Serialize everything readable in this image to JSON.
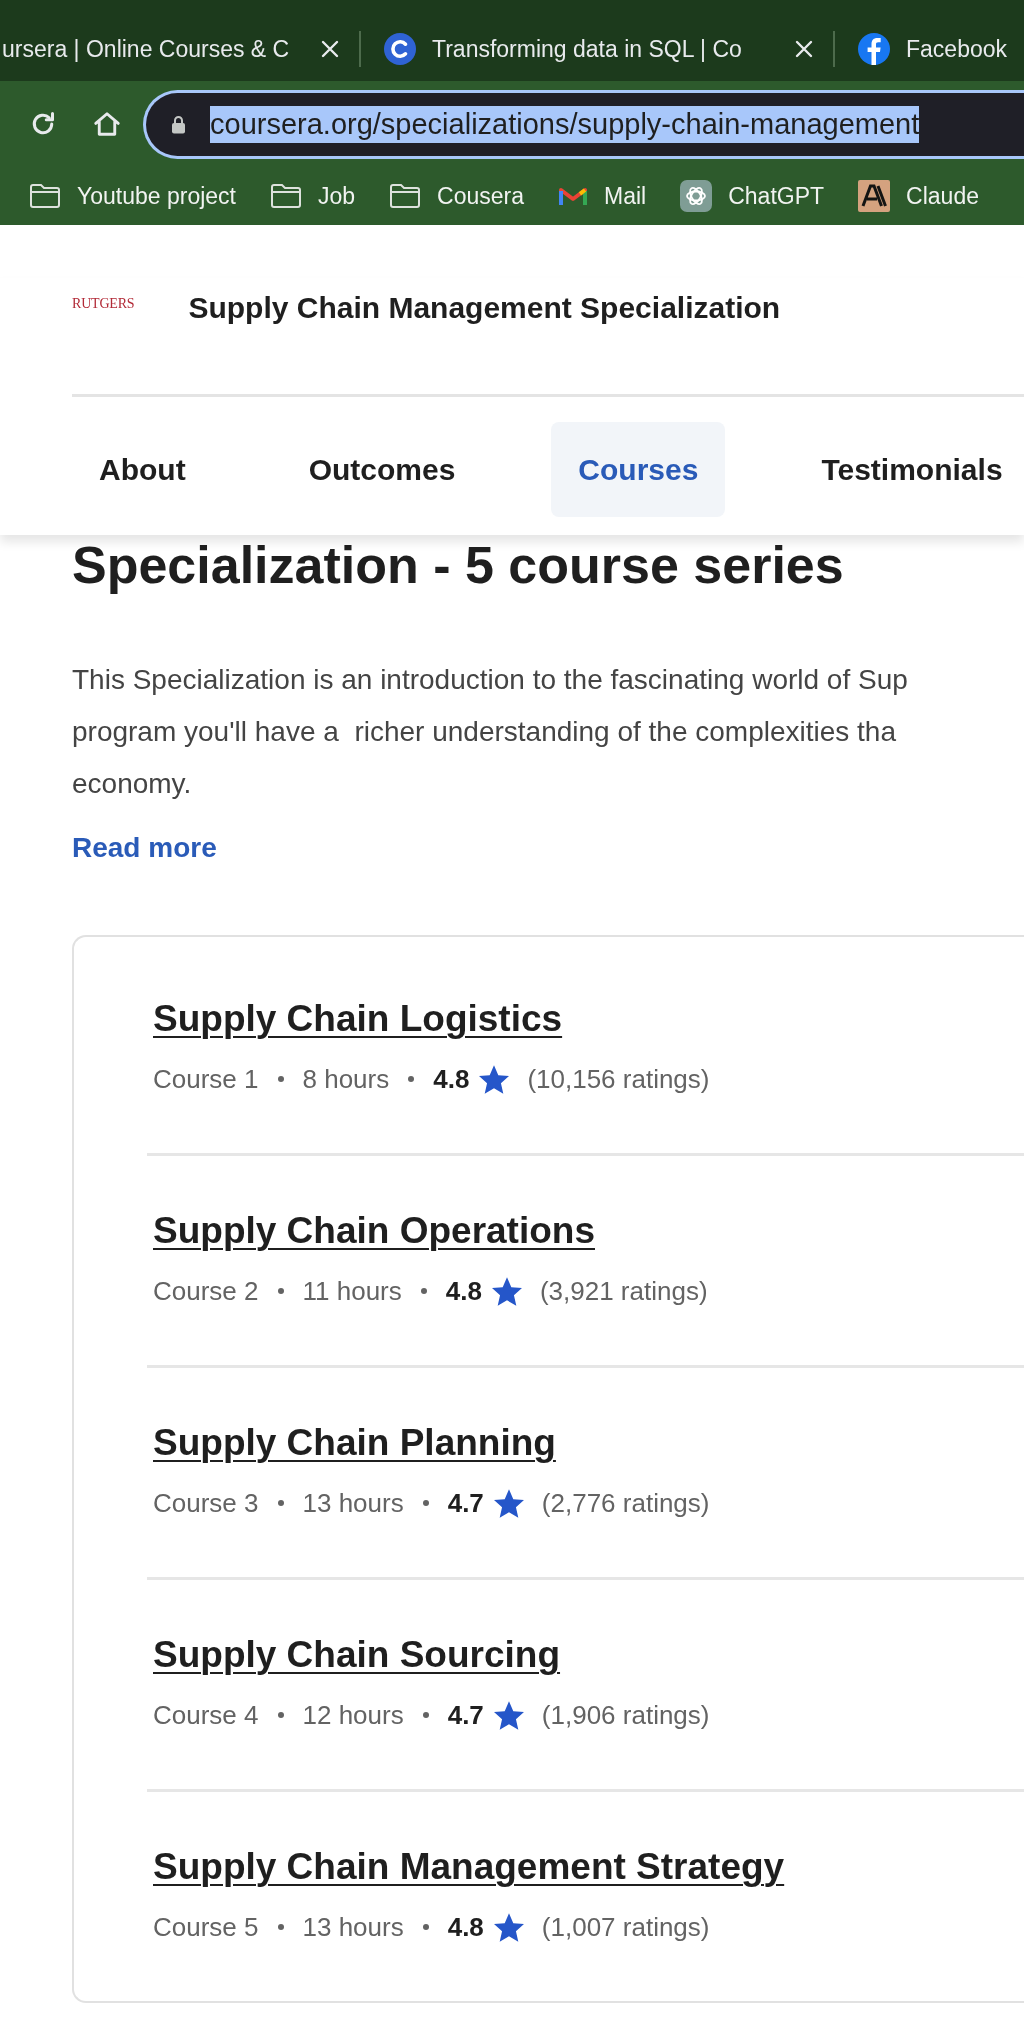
{
  "browser": {
    "tabs": [
      {
        "title": "ursera | Online Courses & C",
        "selected": false,
        "close_button": true
      },
      {
        "title": "Transforming data in SQL | Co",
        "selected": false,
        "close_button": true
      },
      {
        "title": "Facebook",
        "selected": false,
        "close_button": false
      }
    ],
    "address_bar": {
      "url": "coursera.org/specializations/supply-chain-management",
      "url_highlighted": true
    },
    "bookmarks": [
      {
        "label": "Youtube project",
        "kind": "folder"
      },
      {
        "label": "Job",
        "kind": "folder"
      },
      {
        "label": "Cousera",
        "kind": "folder"
      },
      {
        "label": "Mail",
        "kind": "site"
      },
      {
        "label": "ChatGPT",
        "kind": "site"
      },
      {
        "label": "Claude",
        "kind": "site"
      }
    ]
  },
  "header": {
    "logo": "RUTGERS",
    "title": "Supply Chain Management Specialization"
  },
  "nav_tabs": [
    {
      "label": "About",
      "selected": false
    },
    {
      "label": "Outcomes",
      "selected": false
    },
    {
      "label": "Courses",
      "selected": true
    },
    {
      "label": "Testimonials",
      "selected": false
    }
  ],
  "intro": {
    "heading": "Specialization - 5 course series",
    "description_lines": [
      "This Specialization is an introduction to the fascinating world of Sup",
      "program you'll have a  richer understanding of the complexities tha",
      "economy."
    ],
    "read_more": "Read more"
  },
  "courses": [
    {
      "title": "Supply Chain Logistics",
      "course": "Course 1",
      "duration": "8 hours",
      "rating": "4.8",
      "ratings_count": "(10,156 ratings)"
    },
    {
      "title": "Supply Chain Operations",
      "course": "Course 2",
      "duration": "11 hours",
      "rating": "4.8",
      "ratings_count": "(3,921 ratings)"
    },
    {
      "title": "Supply Chain Planning",
      "course": "Course 3",
      "duration": "13 hours",
      "rating": "4.7",
      "ratings_count": "(2,776 ratings)"
    },
    {
      "title": "Supply Chain Sourcing",
      "course": "Course 4",
      "duration": "12 hours",
      "rating": "4.7",
      "ratings_count": "(1,906 ratings)"
    },
    {
      "title": "Supply Chain Management Strategy",
      "course": "Course 5",
      "duration": "13 hours",
      "rating": "4.8",
      "ratings_count": "(1,007 ratings)"
    }
  ]
}
